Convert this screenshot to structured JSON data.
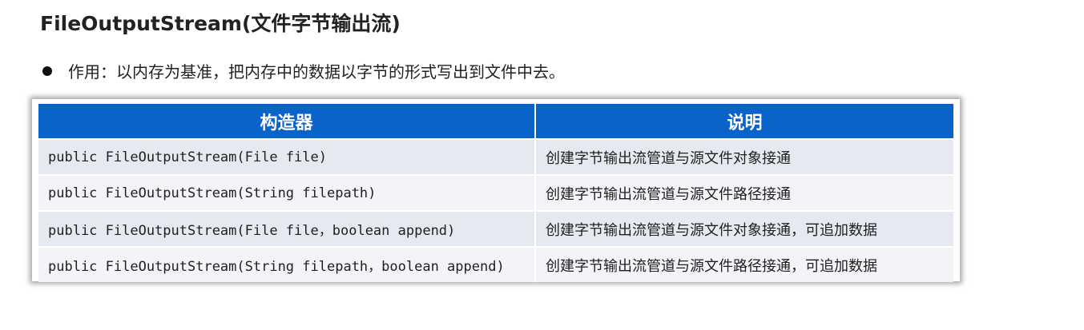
{
  "title": "FileOutputStream(文件字节输出流)",
  "bullet": "作用：以内存为基准，把内存中的数据以字节的形式写出到文件中去。",
  "table": {
    "headers": [
      "构造器",
      "说明"
    ],
    "rows": [
      {
        "ctor": "public FileOutputStream(File file)",
        "desc": "创建字节输出流管道与源文件对象接通"
      },
      {
        "ctor": "public FileOutputStream(String filepath)",
        "desc": "创建字节输出流管道与源文件路径接通"
      },
      {
        "ctor": "public FileOutputStream(File file，boolean append)",
        "desc": "创建字节输出流管道与源文件对象接通，可追加数据"
      },
      {
        "ctor": "public FileOutputStream(String filepath，boolean append)",
        "desc": "创建字节输出流管道与源文件路径接通，可追加数据"
      }
    ]
  },
  "colors": {
    "header_bg": "#0a63c9",
    "header_text": "#ffffff",
    "row_odd": "#e6eaf0",
    "row_even": "#f2f4f7"
  }
}
